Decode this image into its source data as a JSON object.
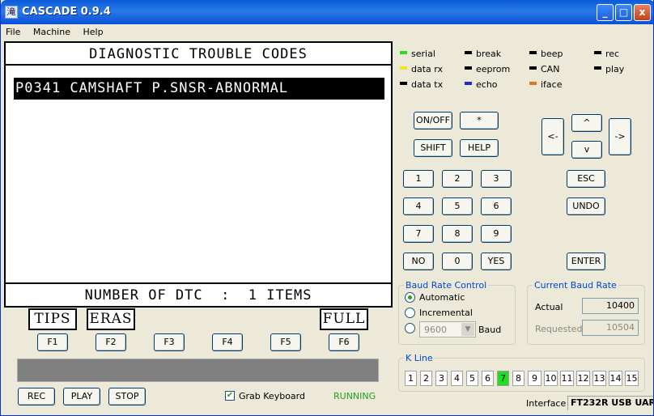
{
  "window": {
    "title": "CASCADE 0.9.4",
    "icon_glyph": "滝",
    "controls": {
      "minimize": "_",
      "maximize": "□",
      "close": "x"
    }
  },
  "menu": [
    "File",
    "Machine",
    "Help"
  ],
  "display": {
    "header": "DIAGNOSTIC TROUBLE CODES",
    "rows": [
      "P0341 CAMSHAFT P.SNSR-ABNORMAL"
    ],
    "footer": "NUMBER OF DTC  :  1 ITEMS"
  },
  "softkeys": {
    "f1": "TIPS",
    "f2": "ERAS",
    "f6": "FULL"
  },
  "fkeys": [
    "F1",
    "F2",
    "F3",
    "F4",
    "F5",
    "F6"
  ],
  "controls": {
    "rec": "REC",
    "play": "PLAY",
    "stop": "STOP",
    "grab_keyboard": "Grab Keyboard",
    "grab_checked": true,
    "state": "RUNNING"
  },
  "indicators": [
    {
      "label": "serial",
      "color": "#22dd22"
    },
    {
      "label": "break",
      "color": "#000000"
    },
    {
      "label": "beep",
      "color": "#000000"
    },
    {
      "label": "rec",
      "color": "#000000"
    },
    {
      "label": "data rx",
      "color": "#f5e51a"
    },
    {
      "label": "eeprom",
      "color": "#000000"
    },
    {
      "label": "CAN",
      "color": "#000000"
    },
    {
      "label": "play",
      "color": "#000000"
    },
    {
      "label": "data tx",
      "color": "#000000"
    },
    {
      "label": "echo",
      "color": "#1a2cd8"
    },
    {
      "label": "iface",
      "color": "#e07820"
    }
  ],
  "keypad": {
    "onoff": "ON/OFF",
    "star": "*",
    "shift": "SHIFT",
    "help": "HELP",
    "left": "<-",
    "up": "^",
    "down": "v",
    "right": "->",
    "digits": [
      "1",
      "2",
      "3",
      "4",
      "5",
      "6",
      "7",
      "8",
      "9"
    ],
    "no": "NO",
    "zero": "0",
    "yes": "YES",
    "esc": "ESC",
    "undo": "UNDO",
    "enter": "ENTER"
  },
  "baud_control": {
    "title": "Baud Rate Control",
    "automatic": "Automatic",
    "incremental": "Incremental",
    "custom_value": "9600",
    "baud_label": "Baud",
    "selected": "automatic"
  },
  "current_baud": {
    "title": "Current Baud Rate",
    "actual_label": "Actual",
    "actual": "10400",
    "requested_label": "Requested",
    "requested": "10504"
  },
  "kline": {
    "title": "K Line",
    "pins": [
      "1",
      "2",
      "3",
      "4",
      "5",
      "6",
      "7",
      "8",
      "9",
      "10",
      "11",
      "12",
      "13",
      "14",
      "15"
    ],
    "active": "7"
  },
  "status": {
    "interface_label": "Interface",
    "interface": "FT232R USB UAR"
  }
}
